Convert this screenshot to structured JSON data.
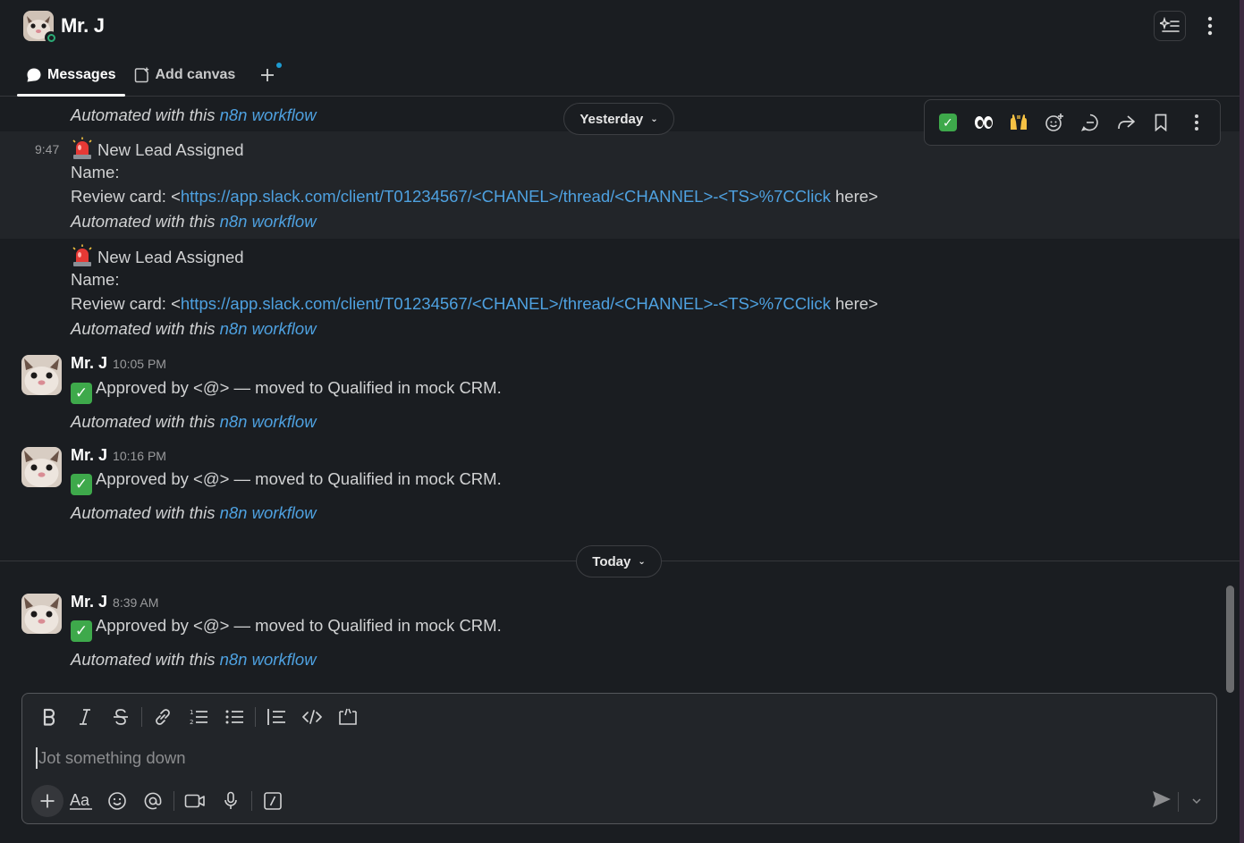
{
  "header": {
    "title": "Mr. J",
    "tabs": [
      {
        "label": "Messages",
        "icon": "message-bubble-icon",
        "active": true
      },
      {
        "label": "Add canvas",
        "icon": "canvas-icon",
        "active": false
      }
    ]
  },
  "date_dividers": {
    "yesterday": "Yesterday",
    "today": "Today"
  },
  "messages": [
    {
      "automated": "Automated with this ",
      "workflow_link": "n8n workflow"
    },
    {
      "time": "9:47",
      "title": "New Lead Assigned",
      "name_line": "Name:",
      "review_prefix": "Review card: <",
      "review_link": "https://app.slack.com/client/T01234567/<CHANEL>/thread/<CHANNEL>-<TS>%7CClick",
      "review_suffix": " here>",
      "automated": "Automated with this ",
      "workflow_link": "n8n workflow"
    },
    {
      "title": "New Lead Assigned",
      "name_line": "Name:",
      "review_prefix": "Review card: <",
      "review_link": "https://app.slack.com/client/T01234567/<CHANEL>/thread/<CHANNEL>-<TS>%7CClick",
      "review_suffix": " here>",
      "automated": "Automated with this ",
      "workflow_link": "n8n workflow"
    },
    {
      "author": "Mr. J",
      "time": "10:05 PM",
      "text": "Approved by <@> — moved to Qualified in mock CRM.",
      "automated": "Automated with this ",
      "workflow_link": "n8n workflow"
    },
    {
      "author": "Mr. J",
      "time": "10:16 PM",
      "text": "Approved by <@> — moved to Qualified in mock CRM.",
      "automated": "Automated with this ",
      "workflow_link": "n8n workflow"
    },
    {
      "author": "Mr. J",
      "time": "8:39 AM",
      "text": "Approved by <@> — moved to Qualified in mock CRM.",
      "automated": "Automated with this ",
      "workflow_link": "n8n workflow"
    }
  ],
  "message_actions": [
    "check-mark-reaction",
    "eyes-reaction",
    "raised-hands-reaction",
    "add-reaction-icon",
    "reply-thread-icon",
    "forward-icon",
    "bookmark-icon",
    "more-actions-icon"
  ],
  "composer": {
    "placeholder": "Jot something down",
    "formatting": [
      "bold-icon",
      "italic-icon",
      "strikethrough-icon",
      "link-icon",
      "ordered-list-icon",
      "bulleted-list-icon",
      "blockquote-icon",
      "code-icon",
      "code-block-icon"
    ],
    "actions": [
      "plus-icon",
      "text-format-icon",
      "emoji-icon",
      "mention-icon",
      "video-clip-icon",
      "audio-clip-icon",
      "shortcuts-icon"
    ]
  },
  "colors": {
    "background": "#1a1d21",
    "link": "#4ea1e0",
    "hover_row": "#222529",
    "presence": "#2bac76"
  }
}
